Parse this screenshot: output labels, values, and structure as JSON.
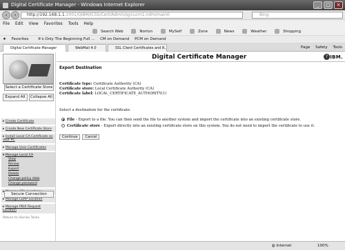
{
  "window": {
    "title": "Digital Certificate Manager - Windows Internet Explorer",
    "controls": {
      "minimize": "_",
      "maximize": "□",
      "close": "×"
    }
  },
  "address": {
    "url_main": "http://192.168.1.1",
    "url_rest": ":2001/QIBM/ICSS/Cert/Admin/qycucm1.ndm/main0",
    "search_placeholder": "Bing"
  },
  "menu": [
    "File",
    "Edit",
    "View",
    "Favorites",
    "Tools",
    "Help"
  ],
  "toolbar": {
    "items": [
      "Search Web",
      "Norton",
      "MySelf",
      "Zone",
      "News",
      "Weather",
      "Shopping"
    ]
  },
  "favorites_bar": {
    "favorites_label": "Favorites",
    "links": [
      "It's Only The Beginning Full ...",
      "CM on Demand",
      "PCM on Demand"
    ]
  },
  "tabs": [
    {
      "label": "Digital Certificate Manager",
      "active": true
    },
    {
      "label": "WebMail 4.0",
      "active": false
    },
    {
      "label": "SSL Client Certificates and R...",
      "active": false
    }
  ],
  "tab_tools": [
    "Page",
    "Safety",
    "Tools"
  ],
  "header": {
    "title": "Digital Certificate Manager",
    "help": "?",
    "logo": "IBM."
  },
  "sidebar": {
    "select_store_button": "Select a Certificate Store",
    "expand_all": "Expand All",
    "collapse_all": "Collapse All",
    "nav": [
      "Create Certificate",
      "Create New Certificate Store",
      "Install Local CA Certificate on Your PC",
      "Manage User Certificates"
    ],
    "manage_local_ca": {
      "label": "Manage Local CA",
      "sub": [
        "View",
        "Renew",
        "Export",
        "Delete",
        "Change policy data",
        "Change password"
      ]
    },
    "nav_after": [
      "Manage CRL Locations",
      "Manage LDAP Location",
      "Manage PKIX Request Location"
    ],
    "return_link": "Return to iSeries Tasks",
    "secure_connection": "Secure Connection"
  },
  "main": {
    "title": "Export Destination",
    "cert_type_label": "Certificate type:",
    "cert_type_value": "Certificate Authority (CA)",
    "cert_store_label": "Certificate store:",
    "cert_store_value": "Local Certificate Authority (CA)",
    "cert_label_label": "Certificate label:",
    "cert_label_value": "LOCAL_CERTIFICATE_AUTHORITY(1)",
    "prompt": "Select a destination for the certificate.",
    "option_file_label": "File",
    "option_file_desc": " - Export to a file. You can then send the file to another system and import the certificate into an existing certificate store.",
    "option_store_label": "Certificate store",
    "option_store_desc": " - Export directly into an existing certificate store on this system. You do not need to import the certificate to use it.",
    "continue": "Continue",
    "cancel": "Cancel"
  },
  "status": {
    "zone": "Internet",
    "zoom": "100%"
  }
}
